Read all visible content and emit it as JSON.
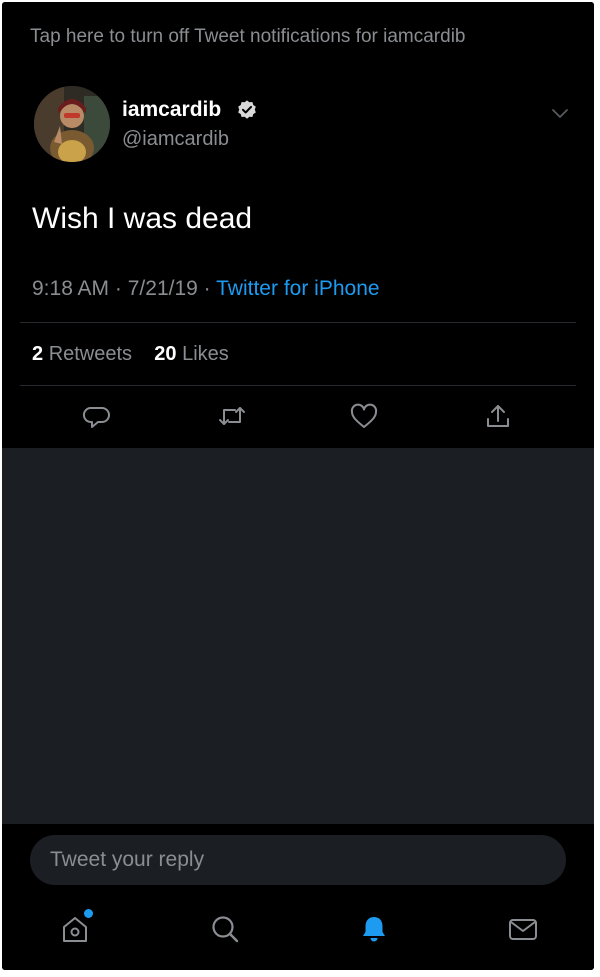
{
  "notification_bar": {
    "text": "Tap here to turn off Tweet notifications for iamcardib"
  },
  "author": {
    "display_name": "iamcardib",
    "handle": "@iamcardib"
  },
  "tweet": {
    "text": "Wish I was dead",
    "time": "9:18 AM",
    "separator": "·",
    "date": "7/21/19",
    "source": "Twitter for iPhone"
  },
  "stats": {
    "retweets_count": "2",
    "retweets_label": "Retweets",
    "likes_count": "20",
    "likes_label": "Likes"
  },
  "actions": [
    "reply-icon",
    "retweet-icon",
    "like-icon",
    "share-icon"
  ],
  "reply": {
    "placeholder": "Tweet your reply"
  },
  "bottom_nav": [
    "home-icon",
    "search-icon",
    "notifications-icon",
    "messages-icon"
  ],
  "colors": {
    "accent": "#1d9bf0",
    "background": "#000000",
    "secondary_text": "#8a8d91"
  }
}
